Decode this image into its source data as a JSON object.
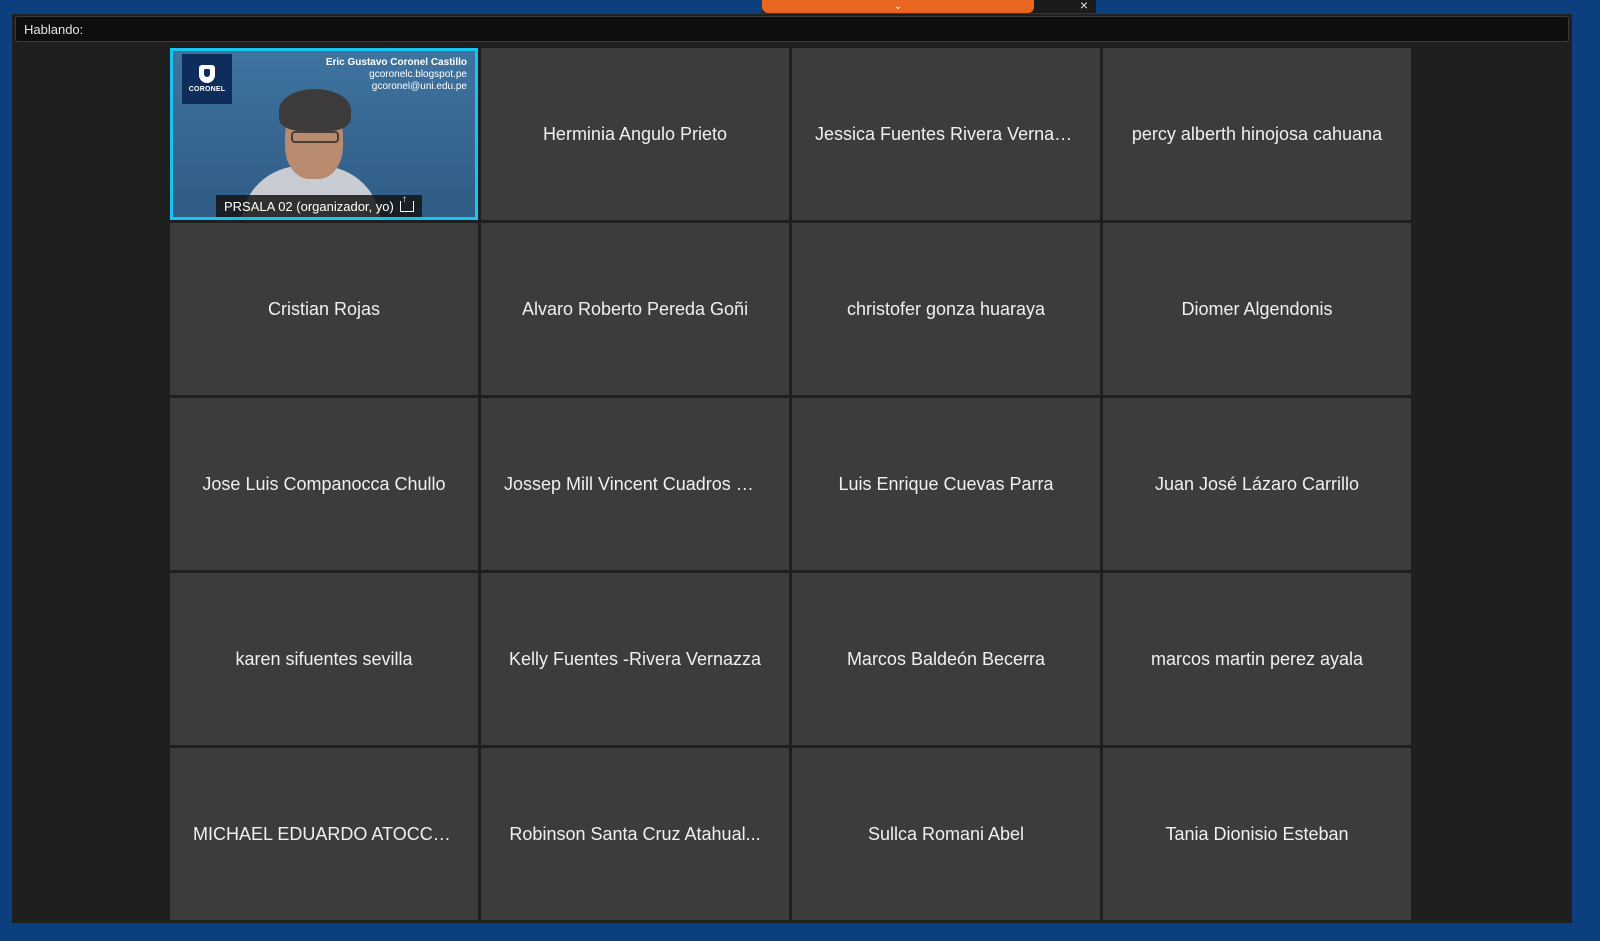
{
  "topbar": {
    "chevron_icon": "chevron-down-icon",
    "close_label": "×"
  },
  "speaking_bar": {
    "label": "Hablando:"
  },
  "active_tile": {
    "name_tag": "PRSALA 02  (organizador, yo)",
    "overlay_name": "Eric Gustavo Coronel Castillo",
    "overlay_blog": "gcoronelc.blogspot.pe",
    "overlay_email": "gcoronel@uni.edu.pe",
    "logo_text": "CORONEL",
    "accent_color": "#16c6f0"
  },
  "participants": [
    "Herminia Angulo Prieto",
    "Jessica Fuentes Rivera Vernazza",
    "percy alberth hinojosa cahuana",
    "Cristian Rojas",
    "Alvaro Roberto Pereda Goñi",
    "christofer gonza huaraya",
    "Diomer Algendonis",
    "Jose Luis Companocca Chullo",
    "Jossep Mill Vincent Cuadros Go...",
    "Luis Enrique Cuevas Parra",
    "Juan José Lázaro Carrillo",
    "karen sifuentes sevilla",
    "Kelly Fuentes -Rivera Vernazza",
    "Marcos Baldeón Becerra",
    "marcos martin perez ayala",
    "MICHAEL EDUARDO ATOCCS...",
    "Robinson Santa Cruz Atahual...",
    "Sullca Romani Abel",
    "Tania Dionisio Esteban"
  ],
  "colors": {
    "desktop": "#0b3f7d",
    "window": "#1f1f1f",
    "tile": "#3c3c3c",
    "topbar_handle": "#e8661f"
  }
}
